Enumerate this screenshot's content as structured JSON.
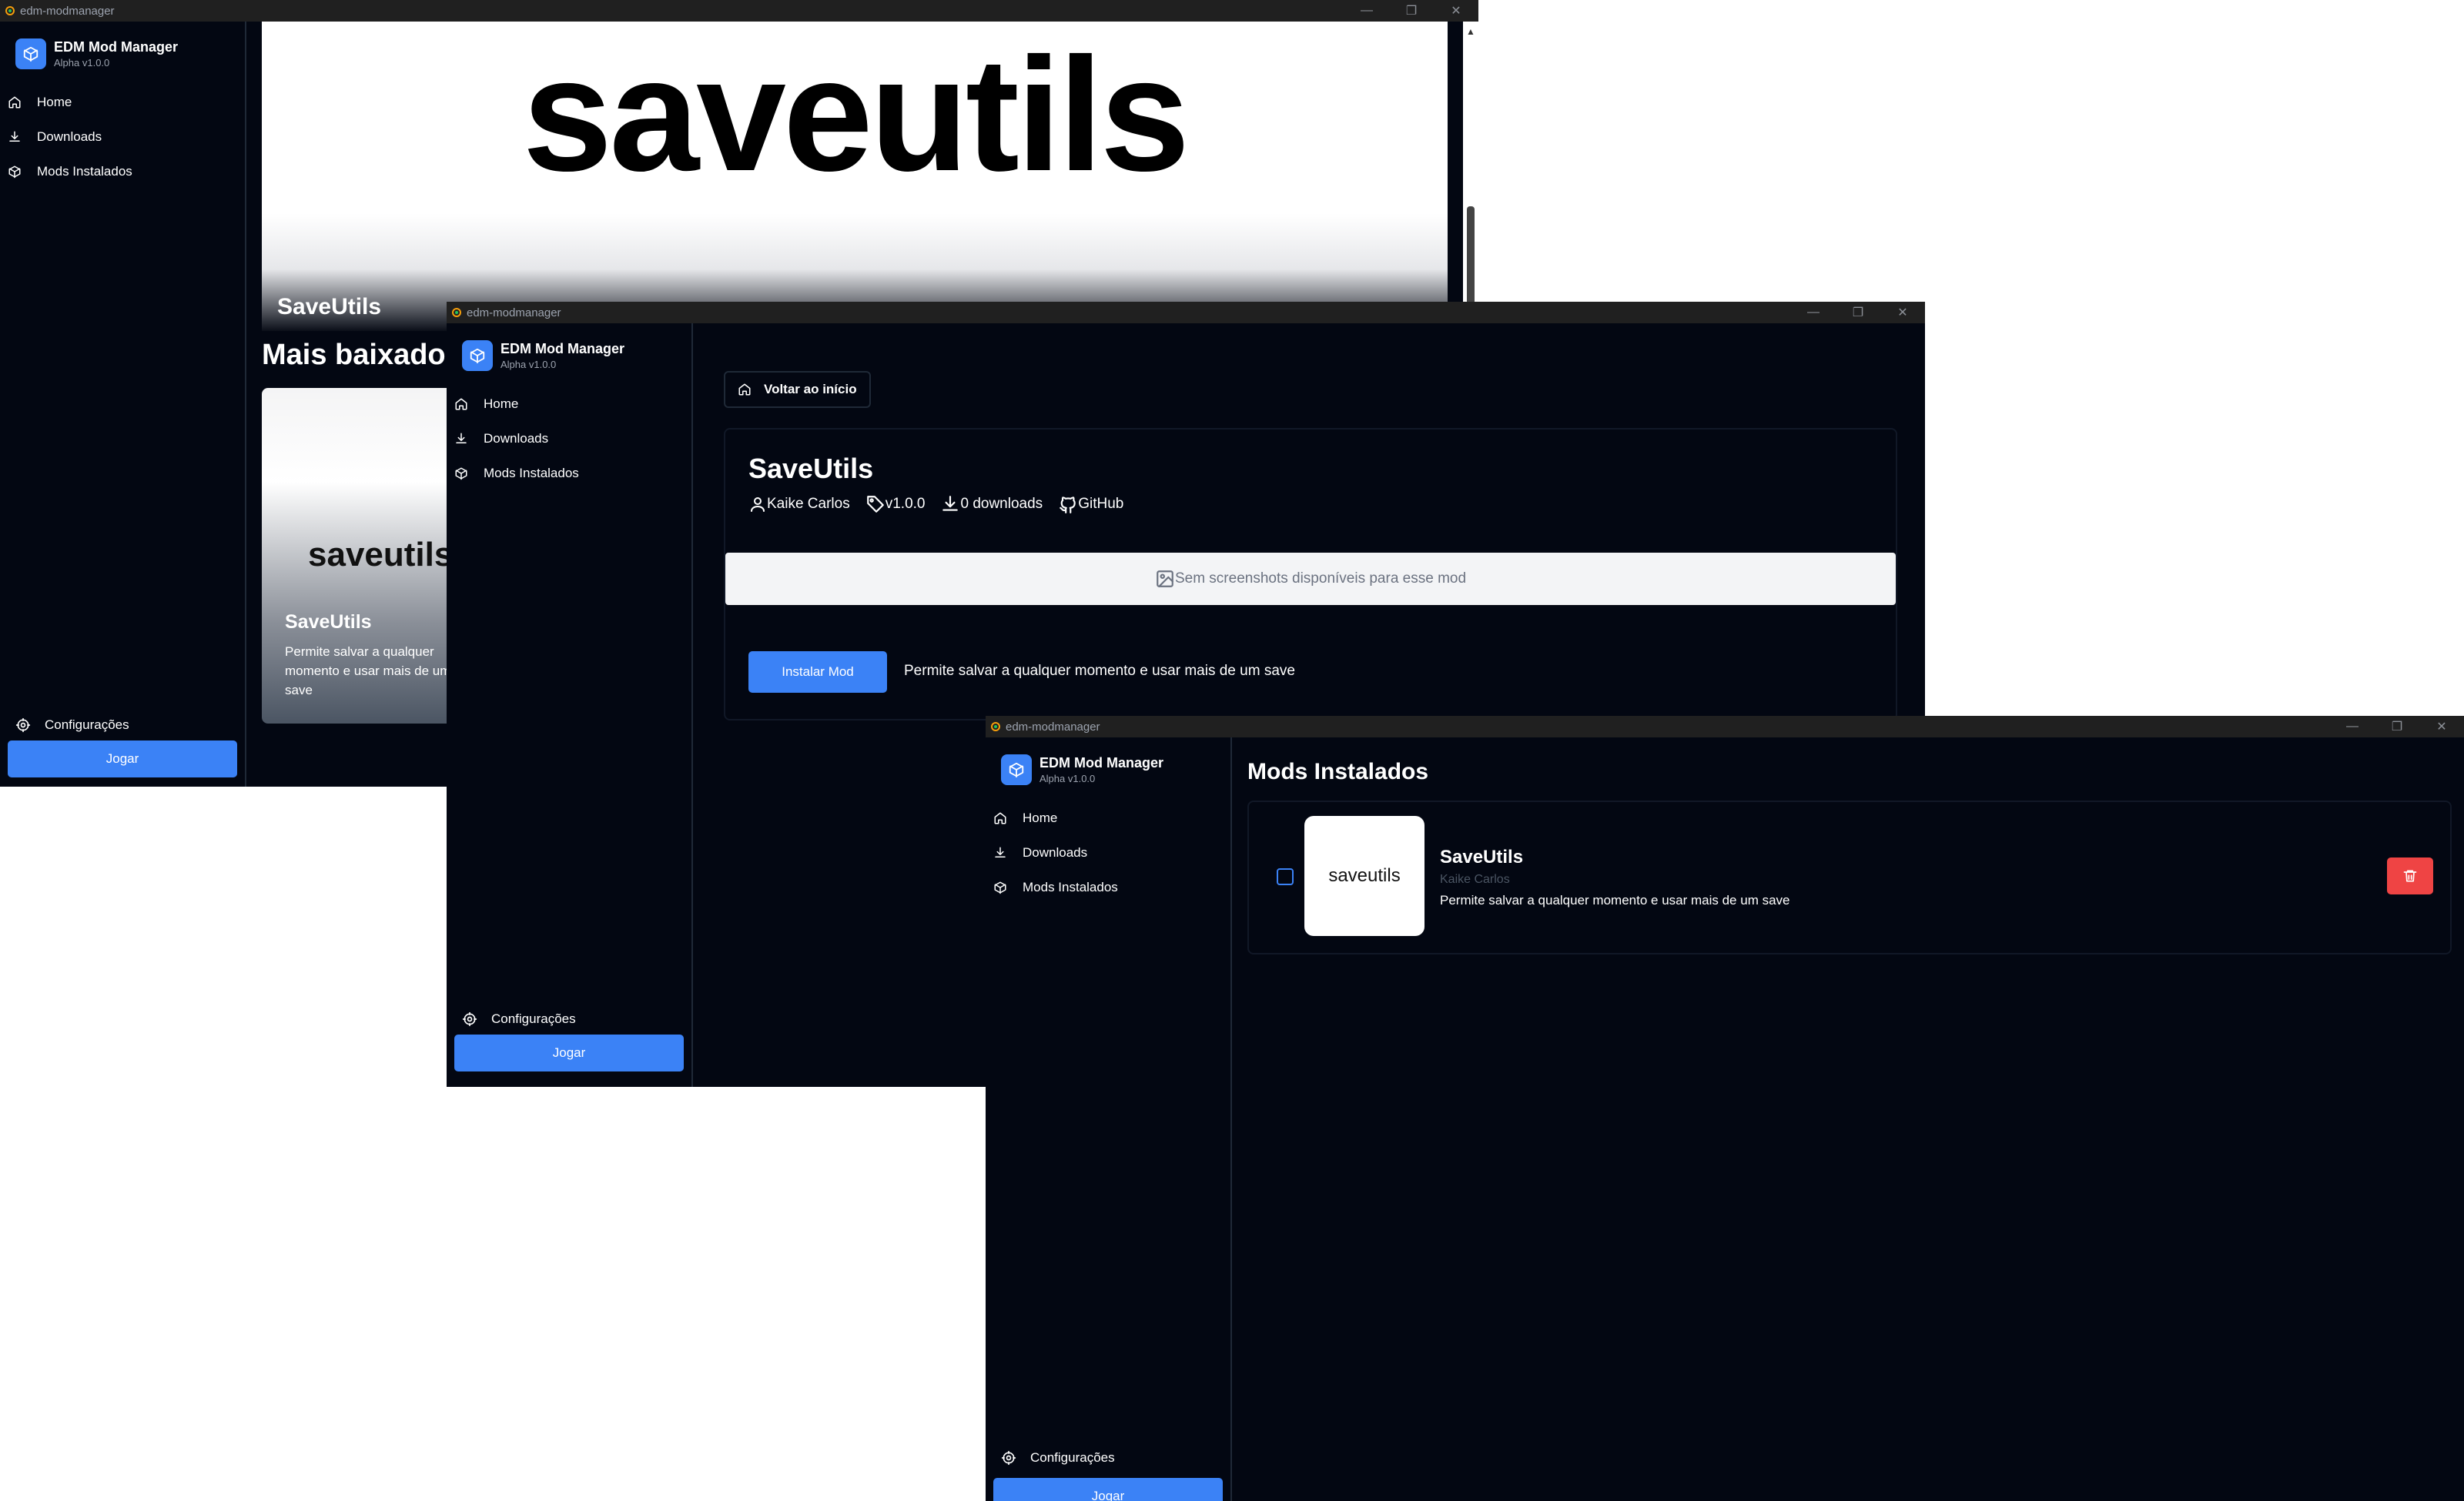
{
  "app": {
    "window_title": "edm-modmanager",
    "name": "EDM Mod Manager",
    "version": "Alpha v1.0.0",
    "nav": [
      "Home",
      "Downloads",
      "Mods Instalados"
    ],
    "settings_label": "Configurações",
    "play_label": "Jogar"
  },
  "colors": {
    "background": "#030712",
    "accent": "#3b82f6",
    "danger": "#ef4444",
    "border": "#1f2937"
  },
  "home_window": {
    "hero_image_text": "saveutils",
    "hero_title": "SaveUtils",
    "section_title": "Mais baixados",
    "card": {
      "image_text": "saveutils",
      "title": "SaveUtils",
      "description": "Permite salvar a qualquer momento e usar mais de um save"
    }
  },
  "detail_window": {
    "back_label": "Voltar ao início",
    "mod_title": "SaveUtils",
    "author": "Kaike Carlos",
    "version": "v1.0.0",
    "downloads": "0 downloads",
    "github_label": "GitHub",
    "no_screenshots": "Sem screenshots disponíveis para esse mod",
    "install_label": "Instalar Mod",
    "description": "Permite salvar a qualquer momento e usar mais de um save"
  },
  "installed_window": {
    "page_title": "Mods Instalados",
    "mods": [
      {
        "thumb_text": "saveutils",
        "name": "SaveUtils",
        "author": "Kaike Carlos",
        "description": "Permite salvar a qualquer momento e usar mais de um save",
        "checked": false
      }
    ]
  },
  "icons": [
    "app-icon",
    "box-logo-icon",
    "home-icon",
    "download-icon",
    "box-icon",
    "gear-icon",
    "user-icon",
    "tag-icon",
    "github-icon",
    "image-icon",
    "trash-icon",
    "minimize-icon",
    "maximize-icon",
    "close-icon"
  ]
}
